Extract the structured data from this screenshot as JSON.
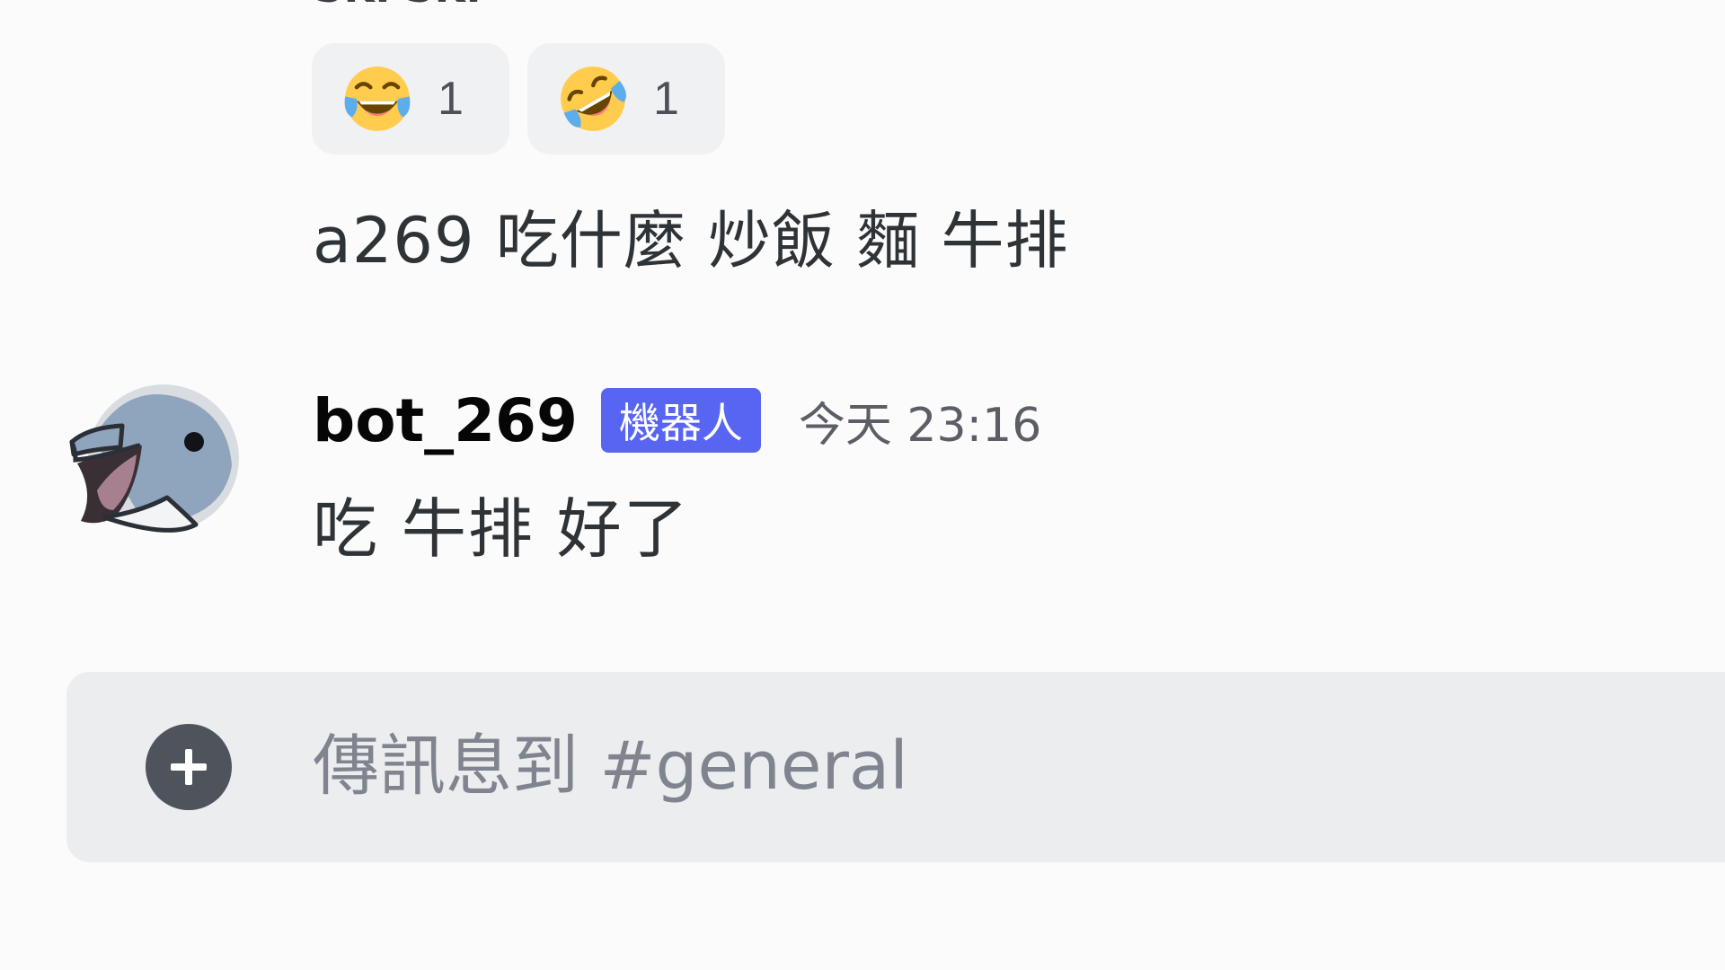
{
  "previous_message": {
    "cut_off_text": "SKPSKP",
    "reactions": [
      {
        "emoji": "face-with-tears-of-joy-icon",
        "count": "1"
      },
      {
        "emoji": "rolling-on-the-floor-laughing-icon",
        "count": "1"
      }
    ],
    "text": "a269 吃什麼 炒飯 麵 牛排"
  },
  "bot_message": {
    "author": "bot_269",
    "badge": "機器人",
    "timestamp": "今天 23:16",
    "text": "吃 牛排 好了",
    "avatar": "dolphin-avatar-icon"
  },
  "composer": {
    "placeholder": "傳訊息到 #general",
    "value": "",
    "attach_icon": "plus-circle-icon"
  },
  "colors": {
    "background": "#fbfbfb",
    "reaction_bg": "#f0f1f2",
    "badge_bg": "#5865f2",
    "composer_bg": "#ebedef",
    "attach_bg": "#4f545c"
  }
}
